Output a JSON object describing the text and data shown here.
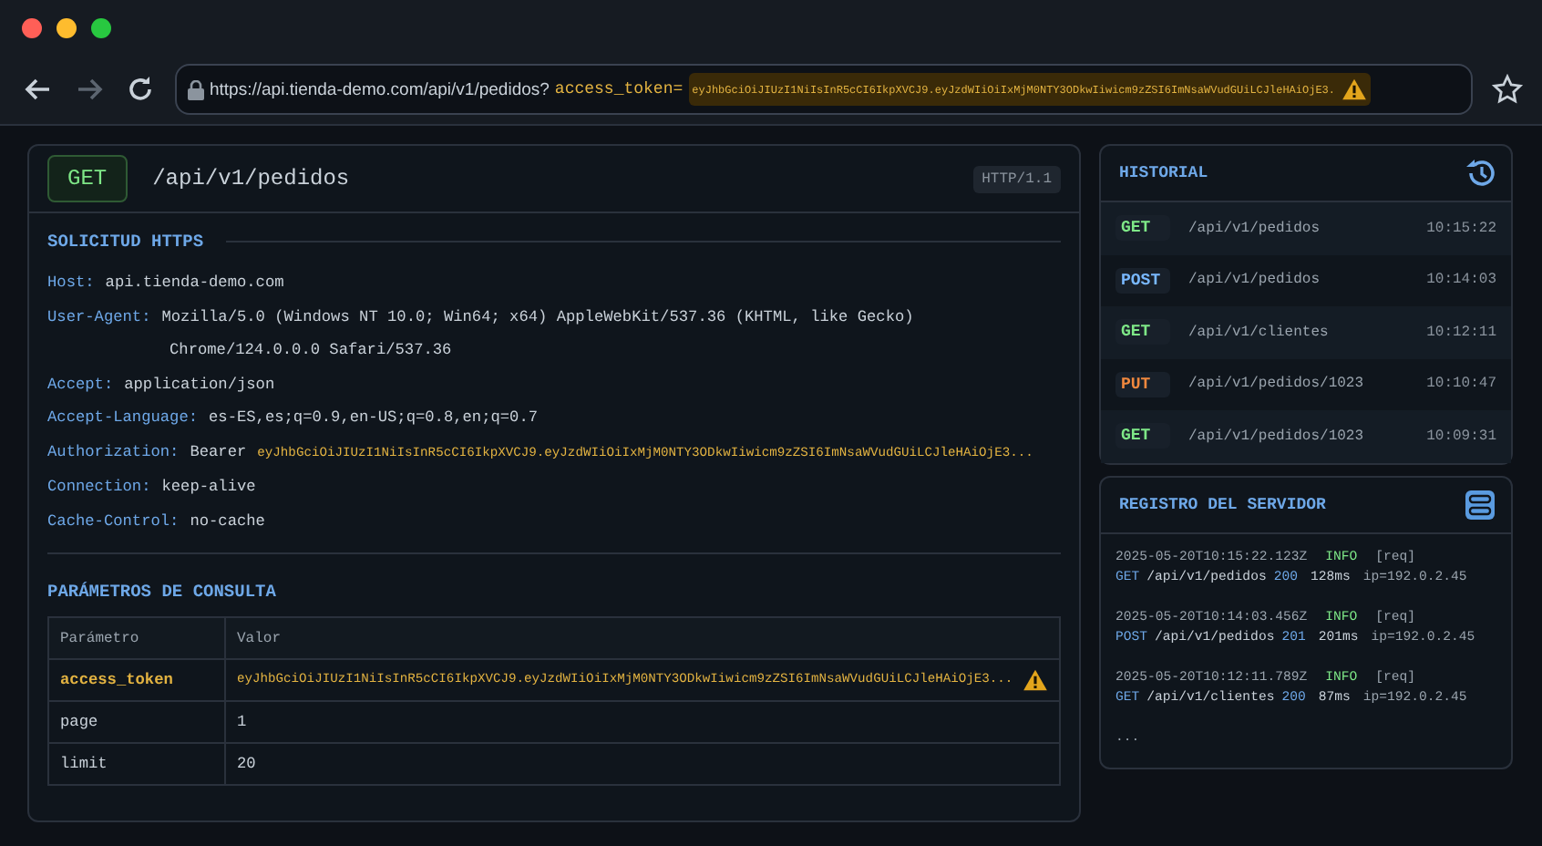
{
  "browser": {
    "url_prefix": "https://api.tienda-demo.com/api/v1/pedidos?",
    "url_param": "access_token=",
    "url_token": "eyJhbGciOiJIUzI1NiIsInR5cCI6IkpXVCJ9.eyJzdWIiOiIxMjM0NTY3ODkwIiwicm9zZSI6ImNsaWVudGUiLCJleHAiOjE3.",
    "url_warning": true
  },
  "request": {
    "method": "GET",
    "path": "/api/v1/pedidos",
    "protocol": "HTTP/1.1",
    "section_title": "SOLICITUD HTTPS",
    "headers": [
      {
        "name": "Host:",
        "value": "api.tienda-demo.com"
      },
      {
        "name": "User-Agent:",
        "value": "Mozilla/5.0 (Windows NT 10.0; Win64; x64) AppleWebKit/537.36 (KHTML, like Gecko)",
        "continuation": "Chrome/124.0.0.0 Safari/537.36"
      },
      {
        "name": "Accept:",
        "value": "application/json"
      },
      {
        "name": "Accept-Language:",
        "value": "es-ES,es;q=0.9,en-US;q=0.8,en;q=0.7"
      },
      {
        "name": "Authorization:",
        "value": "Bearer",
        "token": "eyJhbGciOiJIUzI1NiIsInR5cCI6IkpXVCJ9.eyJzdWIiOiIxMjM0NTY3ODkwIiwicm9zZSI6ImNsaWVudGUiLCJleHAiOjE3..."
      },
      {
        "name": "Connection:",
        "value": "keep-alive"
      },
      {
        "name": "Cache-Control:",
        "value": "no-cache"
      }
    ]
  },
  "query": {
    "title": "PARÁMETROS DE CONSULTA",
    "columns": [
      "Parámetro",
      "Valor"
    ],
    "rows": [
      {
        "name": "access_token",
        "value": "eyJhbGciOiJIUzI1NiIsInR5cCI6IkpXVCJ9.eyJzdWIiOiIxMjM0NTY3ODkwIiwicm9zZSI6ImNsaWVudGUiLCJleHAiOjE3...",
        "flagged": true
      },
      {
        "name": "page",
        "value": "1",
        "flagged": false
      },
      {
        "name": "limit",
        "value": "20",
        "flagged": false
      }
    ]
  },
  "history": {
    "title": "HISTORIAL",
    "items": [
      {
        "method": "GET",
        "color": "#7ee787",
        "path": "/api/v1/pedidos",
        "time": "10:15:22"
      },
      {
        "method": "POST",
        "color": "#79b8ff",
        "path": "/api/v1/pedidos",
        "time": "10:14:03"
      },
      {
        "method": "GET",
        "color": "#7ee787",
        "path": "/api/v1/clientes",
        "time": "10:12:11"
      },
      {
        "method": "PUT",
        "color": "#f0883e",
        "path": "/api/v1/pedidos/1023",
        "time": "10:10:47"
      },
      {
        "method": "GET",
        "color": "#7ee787",
        "path": "/api/v1/pedidos/1023",
        "time": "10:09:31"
      }
    ]
  },
  "server_log": {
    "title": "REGISTRO DEL SERVIDOR",
    "entries": [
      {
        "timestamp": "2025-05-20T10:15:22.123Z",
        "level": "INFO",
        "tag": "[req]",
        "method": "GET",
        "path": "/api/v1/pedidos",
        "status": "200",
        "duration": "128ms",
        "ip": "ip=192.0.2.45"
      },
      {
        "timestamp": "2025-05-20T10:14:03.456Z",
        "level": "INFO",
        "tag": "[req]",
        "method": "POST",
        "path": "/api/v1/pedidos",
        "status": "201",
        "duration": "201ms",
        "ip": "ip=192.0.2.45"
      },
      {
        "timestamp": "2025-05-20T10:12:11.789Z",
        "level": "INFO",
        "tag": "[req]",
        "method": "GET",
        "path": "/api/v1/clientes",
        "status": "200",
        "duration": "87ms",
        "ip": "ip=192.0.2.45"
      }
    ],
    "more": "..."
  }
}
